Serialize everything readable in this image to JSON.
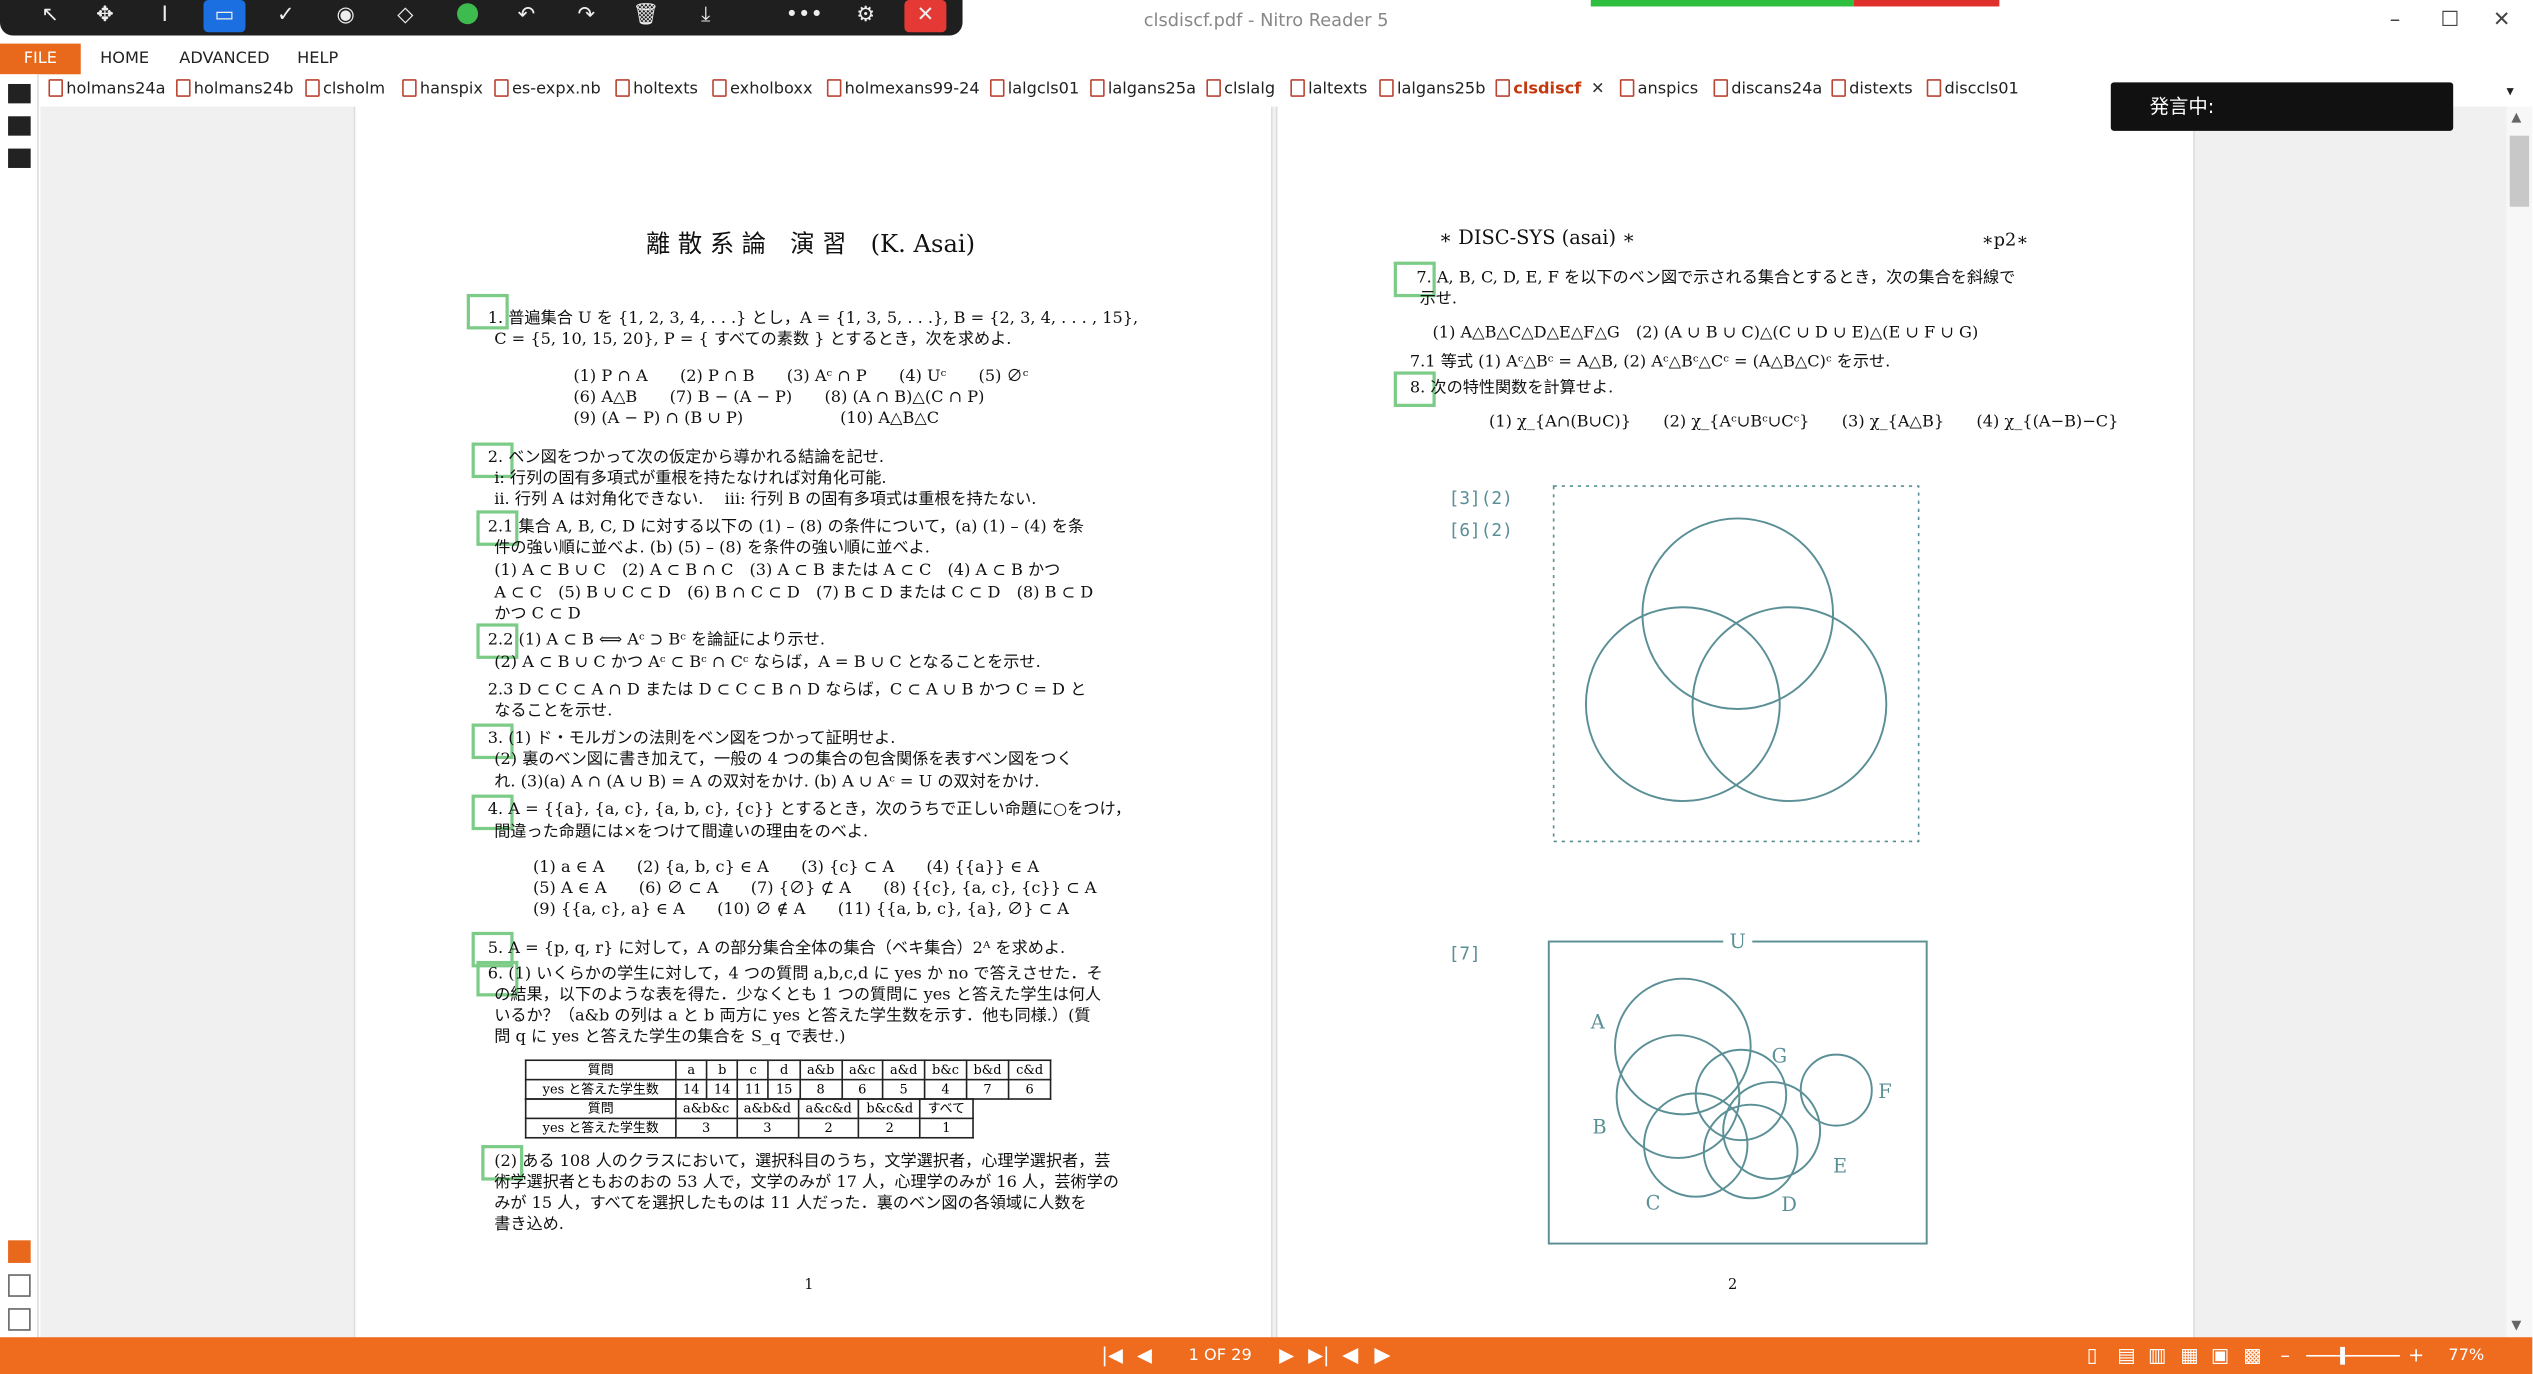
{
  "window": {
    "title": "clsdiscf.pdf - Nitro Reader 5"
  },
  "toolbar": {
    "icons": [
      "select-arrow-icon",
      "pan-icon",
      "text-cursor-icon",
      "rectangle-icon",
      "check-icon",
      "stamp-icon",
      "eraser-icon",
      "green-circle-icon",
      "undo-icon",
      "redo-icon",
      "trash-icon",
      "download-icon",
      "more-icon",
      "user-settings-icon",
      "close-icon"
    ]
  },
  "menu": {
    "file": "FILE",
    "home": "HOME",
    "advanced": "ADVANCED",
    "help": "HELP"
  },
  "tabs": [
    "holmans24a",
    "holmans24b",
    "clsholm",
    "hanspix",
    "es-expx.nb",
    "holtexts",
    "exholboxx",
    "holmexans99-24",
    "lalgcls01",
    "lalgans25a",
    "clslalg",
    "laltexts",
    "lalgans25b",
    "clsdiscf",
    "anspics",
    "discans24a",
    "distexts",
    "disccls01"
  ],
  "active_tab": "clsdiscf",
  "overlay": {
    "speaking": "発言中:"
  },
  "status": {
    "page": "1 OF 29",
    "zoom": "77%"
  },
  "page1": {
    "title": "離 散 系 論　演 習　(K. Asai)",
    "q1": [
      "1. 普遍集合 U を {1, 2, 3, 4, . . .} とし，A = {1, 3, 5, . . .}, B = {2, 3, 4, . . . , 15},",
      "C = {5, 10, 15, 20}, P = { すべての素数 } とするとき，次を求めよ."
    ],
    "q1_items": [
      "(1) P ∩ A　　(2) P ∩ B　　(3) Aᶜ ∩ P　　(4) Uᶜ　　(5) ∅ᶜ",
      "(6) A△B　　(7) B − (A − P)　　(8) (A ∩ B)△(C ∩ P)",
      "(9) (A − P) ∩ (B ∪ P)　　　　　　(10) A△B△C"
    ],
    "q2": [
      "2. ベン図をつかって次の仮定から導かれる結論を記せ.",
      "i: 行列の固有多項式が重根を持たなければ対角化可能.",
      "ii. 行列 A は対角化できない.　 iii: 行列 B の固有多項式は重根を持たない."
    ],
    "q21": [
      "2.1 集合 A, B, C, D に対する以下の (1) – (8) の条件について，(a) (1) – (4) を条",
      "件の強い順に並べよ.  (b) (5) – (8) を条件の強い順に並べよ.",
      "(1) A ⊂ B ∪ C　(2) A ⊂ B ∩ C　(3) A ⊂ B または A ⊂ C　(4) A ⊂ B かつ",
      "A ⊂ C　(5) B ∪ C ⊂ D　(6) B ∩ C ⊂ D　(7) B ⊂ D または C ⊂ D　(8) B ⊂ D",
      "かつ C ⊂ D"
    ],
    "q22": [
      "2.2 (1) A ⊂ B  ⟺  Aᶜ ⊃ Bᶜ を論証により示せ.",
      "(2) A ⊂ B ∪ C かつ Aᶜ ⊂ Bᶜ ∩ Cᶜ ならば，A = B ∪ C となることを示せ."
    ],
    "q23": [
      "2.3 D ⊂ C ⊂ A ∩ D または D ⊂ C ⊂ B ∩ D ならば，C ⊂ A ∪ B かつ C = D と",
      "なることを示せ."
    ],
    "q3": [
      "3. (1) ド・モルガンの法則をベン図をつかって証明せよ.",
      "(2) 裏のベン図に書き加えて，一般の 4 つの集合の包含関係を表すベン図をつく",
      "れ.  (3)(a) A ∩ (A ∪ B) = A の双対をかけ. (b) A ∪ Aᶜ = U の双対をかけ."
    ],
    "q4": [
      "4. A = {{a}, {a, c}, {a, b, c}, {c}} とするとき，次のうちで正しい命題に○をつけ，",
      "間違った命題には×をつけて間違いの理由をのべよ."
    ],
    "q4_items": [
      "(1) a ∈ A　　(2) {a, b, c} ∈ A　　(3) {c} ⊂ A　　(4) {{a}} ∈ A",
      "(5) A ∈ A　　(6) ∅ ⊂ A　　(7) {∅} ⊄ A　　(8) {{c}, {a, c}, {c}} ⊂ A",
      "(9) {{a, c}, a} ∈ A　　(10) ∅ ∉ A　　(11) {{a, b, c}, {a}, ∅} ⊂ A"
    ],
    "q5": "5. A = {p, q, r} に対して，A の部分集合全体の集合（ベキ集合）2ᴬ を求めよ.",
    "q6": [
      "6. (1) いくらかの学生に対して，4 つの質問 a,b,c,d に yes か no で答えさせた．そ",
      "の結果，以下のような表を得た．少なくとも 1 つの質問に yes と答えた学生は何人",
      "いるか？（a&b の列は a と b 両方に yes と答えた学生数を示す．他も同様.）(質",
      "問 q に yes と答えた学生の集合を S_q で表せ.)"
    ],
    "table1": {
      "h": [
        "質問",
        "a",
        "b",
        "c",
        "d",
        "a&b",
        "a&c",
        "a&d",
        "b&c",
        "b&d",
        "c&d"
      ],
      "r": [
        "yes と答えた学生数",
        "14",
        "14",
        "11",
        "15",
        "8",
        "6",
        "5",
        "4",
        "7",
        "6"
      ]
    },
    "table2": {
      "h": [
        "質問",
        "a&b&c",
        "a&b&d",
        "a&c&d",
        "b&c&d",
        "すべて"
      ],
      "r": [
        "yes と答えた学生数",
        "3",
        "3",
        "2",
        "2",
        "1"
      ]
    },
    "q62": [
      "(2) ある 108 人のクラスにおいて，選択科目のうち，文学選択者，心理学選択者，芸",
      "術学選択者ともおのおの 53 人で，文学のみが 17 人，心理学のみが 16 人，芸術学の",
      "みが 15 人，すべてを選択したものは 11 人だった．裏のベン図の各領域に人数を",
      "書き込め."
    ],
    "pagenum": "1"
  },
  "page2": {
    "header_left": "∗ DISC-SYS (asai) ∗",
    "header_right": "∗p2∗",
    "q7": [
      "7. A, B, C, D, E, F を以下のベン図で示される集合とするとき，次の集合を斜線で",
      "示せ."
    ],
    "q7_items": "(1) A△B△C△D△E△F△G　(2) (A ∪ B ∪ C)△(C ∪ D ∪ E)△(E ∪ F ∪ G)",
    "q71": "7.1 等式 (1) Aᶜ△Bᶜ = A△B,  (2) Aᶜ△Bᶜ△Cᶜ = (A△B△C)ᶜ を示せ.",
    "q8": "8. 次の特性関数を計算せよ.",
    "q8_items": "(1) χ_{A∩(B∪C)}　　(2) χ_{Aᶜ∪Bᶜ∪Cᶜ}　　(3) χ_{A△B}　　(4) χ_{(A−B)−C}",
    "label1": "[3](2)",
    "label2": "[6](2)",
    "label3": "[7]",
    "venn_labels": {
      "U": "U",
      "A": "A",
      "B": "B",
      "C": "C",
      "D": "D",
      "E": "E",
      "F": "F",
      "G": "G"
    },
    "pagenum": "2"
  }
}
